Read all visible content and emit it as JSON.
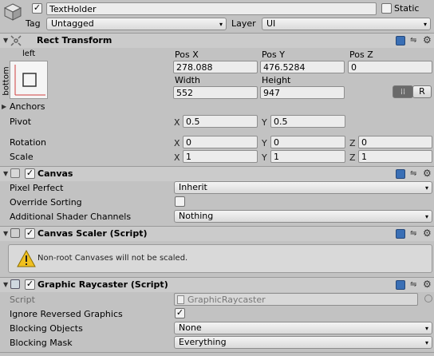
{
  "object": {
    "name": "TextHolder",
    "static_label": "Static",
    "tag_label": "Tag",
    "tag_value": "Untagged",
    "layer_label": "Layer",
    "layer_value": "UI"
  },
  "rect_transform": {
    "title": "Rect Transform",
    "anchor_top_label": "left",
    "anchor_side_label": "bottom",
    "pos_x_label": "Pos X",
    "pos_y_label": "Pos Y",
    "pos_z_label": "Pos Z",
    "pos_x": "278.088",
    "pos_y": "476.5284",
    "pos_z": "0",
    "width_label": "Width",
    "height_label": "Height",
    "width": "552",
    "height": "947",
    "raw_button": "R",
    "anchors_label": "Anchors",
    "pivot_label": "Pivot",
    "pivot_x": "0.5",
    "pivot_y": "0.5",
    "rotation_label": "Rotation",
    "rotation_x": "0",
    "rotation_y": "0",
    "rotation_z": "0",
    "scale_label": "Scale",
    "scale_x": "1",
    "scale_y": "1",
    "scale_z": "1",
    "axis_x": "X",
    "axis_y": "Y",
    "axis_z": "Z"
  },
  "canvas": {
    "title": "Canvas",
    "pixel_perfect_label": "Pixel Perfect",
    "pixel_perfect_value": "Inherit",
    "override_sorting_label": "Override Sorting",
    "shader_channels_label": "Additional Shader Channels",
    "shader_channels_value": "Nothing"
  },
  "canvas_scaler": {
    "title": "Canvas Scaler (Script)",
    "warning": "Non-root Canvases will not be scaled."
  },
  "graphic_raycaster": {
    "title": "Graphic Raycaster (Script)",
    "script_label": "Script",
    "script_value": "GraphicRaycaster",
    "ignore_reversed_label": "Ignore Reversed Graphics",
    "blocking_objects_label": "Blocking Objects",
    "blocking_objects_value": "None",
    "blocking_mask_label": "Blocking Mask",
    "blocking_mask_value": "Everything"
  },
  "colors": {
    "panel": "#c2c2c2",
    "field": "#ececec",
    "accent_blue": "#3a6fb5",
    "anchor_red": "#d04040",
    "warning_yellow": "#f0c020"
  }
}
